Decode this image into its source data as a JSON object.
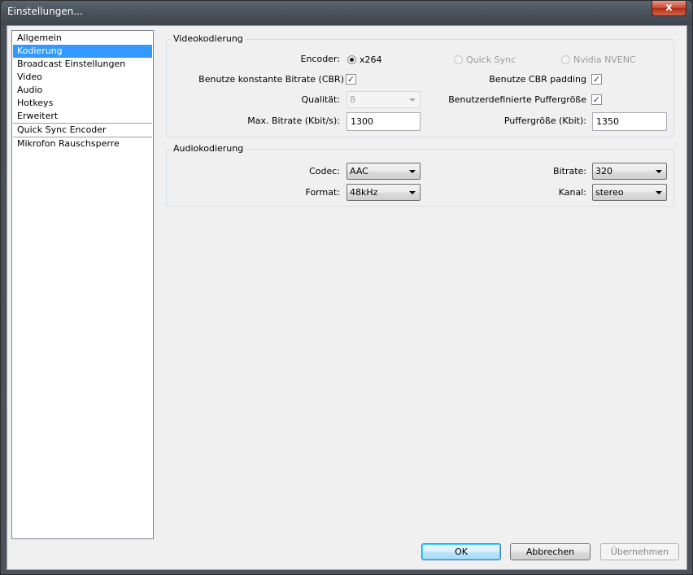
{
  "window": {
    "title": "Einstellungen...",
    "close_glyph": "x"
  },
  "sidebar": {
    "items": [
      {
        "label": "Allgemein",
        "selected": false
      },
      {
        "label": "Kodierung",
        "selected": true
      },
      {
        "label": "Broadcast Einstellungen",
        "selected": false
      },
      {
        "label": "Video",
        "selected": false
      },
      {
        "label": "Audio",
        "selected": false
      },
      {
        "label": "Hotkeys",
        "selected": false
      },
      {
        "label": "Erweitert",
        "selected": false
      },
      {
        "label": "Quick Sync Encoder",
        "selected": false
      },
      {
        "label": "Mikrofon Rauschsperre",
        "selected": false
      }
    ]
  },
  "video": {
    "group_title": "Videokodierung",
    "encoder_label": "Encoder:",
    "encoder_options": [
      {
        "label": "x264",
        "checked": true,
        "enabled": true
      },
      {
        "label": "Quick Sync",
        "checked": false,
        "enabled": false
      },
      {
        "label": "Nvidia NVENC",
        "checked": false,
        "enabled": false
      }
    ],
    "cbr_label": "Benutze konstante Bitrate (CBR)",
    "cbr_checked": true,
    "cbr_padding_label": "Benutze CBR padding",
    "cbr_padding_checked": true,
    "quality_label": "Qualität:",
    "quality_value": "8",
    "custom_buffer_label": "Benutzerdefinierte Puffergröße",
    "custom_buffer_checked": true,
    "max_bitrate_label": "Max. Bitrate (Kbit/s):",
    "max_bitrate_value": "1300",
    "buffer_size_label": "Puffergröße (Kbit):",
    "buffer_size_value": "1350"
  },
  "audio": {
    "group_title": "Audiokodierung",
    "codec_label": "Codec:",
    "codec_value": "AAC",
    "bitrate_label": "Bitrate:",
    "bitrate_value": "320",
    "format_label": "Format:",
    "format_value": "48kHz",
    "channel_label": "Kanal:",
    "channel_value": "stereo"
  },
  "buttons": {
    "ok": "OK",
    "cancel": "Abbrechen",
    "apply": "Übernehmen"
  },
  "check_glyph": "✓"
}
